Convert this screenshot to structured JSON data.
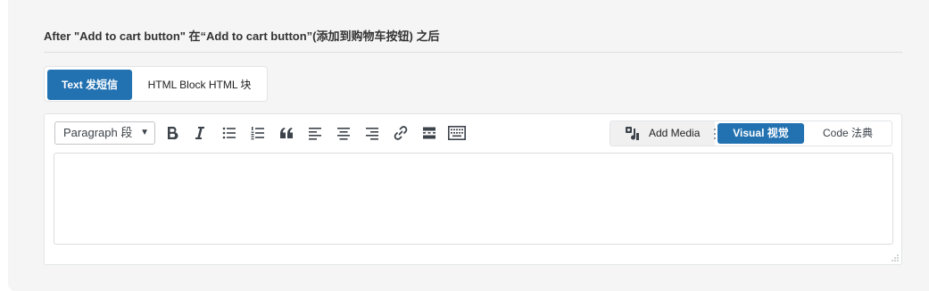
{
  "section": {
    "title": "After \"Add to cart button\"  在“Add to cart button”(添加到购物车按钮) 之后"
  },
  "tabs": [
    {
      "label": "Text  发短信",
      "active": true
    },
    {
      "label": "HTML Block  HTML 块",
      "active": false
    }
  ],
  "toolbar": {
    "format_value": "Paragraph  段",
    "icons": [
      "bold-icon",
      "italic-icon",
      "bulleted-list-icon",
      "numbered-list-icon",
      "blockquote-icon",
      "align-left-icon",
      "align-center-icon",
      "align-right-icon",
      "link-icon",
      "read-more-icon",
      "toolbar-toggle-icon"
    ],
    "add_media_label": "Add Media",
    "visual_label": "Visual   视觉",
    "code_label": "Code   法典"
  },
  "colors": {
    "accent": "#2271b1",
    "panel_bg": "#f5f5f5",
    "border": "#e2e4e7"
  },
  "editor": {
    "content": ""
  }
}
